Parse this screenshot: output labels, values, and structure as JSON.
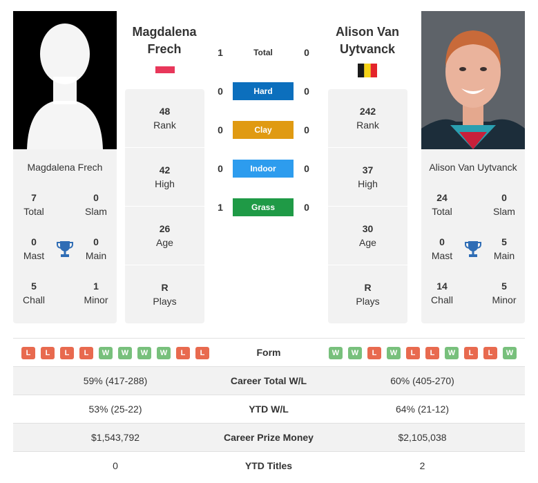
{
  "player1": {
    "name_header": "Magdalena Frech",
    "name_card": "Magdalena Frech",
    "flag": "poland",
    "stats": {
      "total": {
        "value": "7",
        "label": "Total"
      },
      "slam": {
        "value": "0",
        "label": "Slam"
      },
      "mast": {
        "value": "0",
        "label": "Mast"
      },
      "main": {
        "value": "0",
        "label": "Main"
      },
      "chall": {
        "value": "5",
        "label": "Chall"
      },
      "minor": {
        "value": "1",
        "label": "Minor"
      }
    },
    "rank": {
      "value": "48",
      "label": "Rank"
    },
    "high": {
      "value": "42",
      "label": "High"
    },
    "age": {
      "value": "26",
      "label": "Age"
    },
    "plays": {
      "value": "R",
      "label": "Plays"
    },
    "form": [
      "L",
      "L",
      "L",
      "L",
      "W",
      "W",
      "W",
      "W",
      "L",
      "L"
    ],
    "career_wl": "59% (417-288)",
    "ytd_wl": "53% (25-22)",
    "prize_money": "$1,543,792",
    "ytd_titles": "0"
  },
  "player2": {
    "name_header": "Alison Van Uytvanck",
    "name_card": "Alison Van Uytvanck",
    "flag": "belgium",
    "stats": {
      "total": {
        "value": "24",
        "label": "Total"
      },
      "slam": {
        "value": "0",
        "label": "Slam"
      },
      "mast": {
        "value": "0",
        "label": "Mast"
      },
      "main": {
        "value": "5",
        "label": "Main"
      },
      "chall": {
        "value": "14",
        "label": "Chall"
      },
      "minor": {
        "value": "5",
        "label": "Minor"
      }
    },
    "rank": {
      "value": "242",
      "label": "Rank"
    },
    "high": {
      "value": "37",
      "label": "High"
    },
    "age": {
      "value": "30",
      "label": "Age"
    },
    "plays": {
      "value": "R",
      "label": "Plays"
    },
    "form": [
      "W",
      "W",
      "L",
      "W",
      "L",
      "L",
      "W",
      "L",
      "L",
      "W"
    ],
    "career_wl": "60% (405-270)",
    "ytd_wl": "64% (21-12)",
    "prize_money": "$2,105,038",
    "ytd_titles": "2"
  },
  "h2h": {
    "total": {
      "label": "Total",
      "p1": "1",
      "p2": "0"
    },
    "surfaces": [
      {
        "label": "Hard",
        "p1": "0",
        "p2": "0",
        "color": "#0c6fbd"
      },
      {
        "label": "Clay",
        "p1": "0",
        "p2": "0",
        "color": "#e09a12"
      },
      {
        "label": "Indoor",
        "p1": "0",
        "p2": "0",
        "color": "#2d9cee"
      },
      {
        "label": "Grass",
        "p1": "1",
        "p2": "0",
        "color": "#1f9a46"
      }
    ]
  },
  "table_labels": {
    "form": "Form",
    "career_wl": "Career Total W/L",
    "ytd_wl": "YTD W/L",
    "prize_money": "Career Prize Money",
    "ytd_titles": "YTD Titles"
  }
}
